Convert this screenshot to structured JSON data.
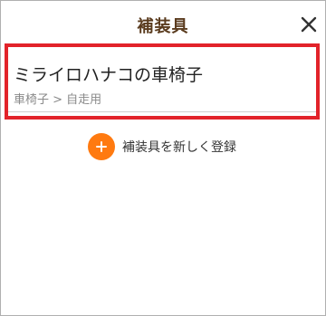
{
  "header": {
    "title": "補装具",
    "close_icon": "close-icon"
  },
  "card": {
    "name": "ミライロハナコの車椅子",
    "subtitle": "車椅子 > 自走用",
    "highlight_color": "#e2232a"
  },
  "add_item": {
    "label": "補装具を新しく登録",
    "icon": "plus-circle-icon",
    "accent_color": "#ff7a10"
  }
}
